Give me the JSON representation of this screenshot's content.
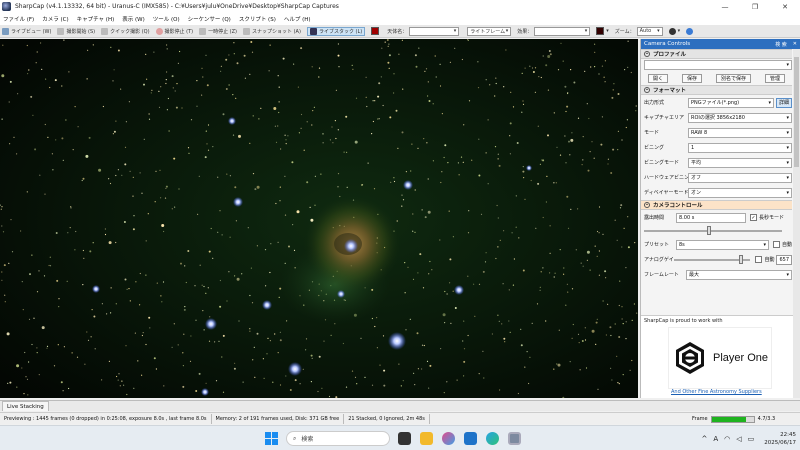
{
  "window": {
    "title": "SharpCap (v4.1.13332, 64 bit) - Uranus-C (IMX585) - C:¥Users¥julu¥OneDrive¥Desktop¥SharpCap Captures",
    "minimize": "—",
    "maximize": "❐",
    "close": "✕"
  },
  "menu": [
    "ファイル (F)",
    "カメラ (C)",
    "キャプチャ (H)",
    "表示 (W)",
    "ツール (O)",
    "シーケンサー (Q)",
    "スクリプト (S)",
    "ヘルプ (H)"
  ],
  "toolbar": {
    "live_view": "ライブビュー (W)",
    "start_capture": "撮影開始 (S)",
    "quick_capture": "クイック撮影 (Q)",
    "stop_capture": "撮影停止 (T)",
    "pause": "一時停止 (Z)",
    "snapshot": "スナップショット (A)",
    "live_stack": "ライブスタック (L)",
    "target_label": "天体名：",
    "frame_select": "ライトフレーム",
    "effect_label": "効果：",
    "zoom_label": "ズーム：",
    "zoom_value": "Auto",
    "target_color": "#a00000",
    "swatch_color": "#330000"
  },
  "camera_controls": {
    "title": "Camera Controls",
    "header_buttons": [
      "検 索",
      "✕"
    ],
    "profile": {
      "label": "プロファイル",
      "buttons": [
        "開く",
        "保存",
        "別名で保存",
        "管理"
      ]
    },
    "format": {
      "label": "フォーマット",
      "rows": [
        {
          "label": "出力形式",
          "value": "PNGファイル(*.png)",
          "extra": "詳細"
        },
        {
          "label": "キャプチャエリア",
          "value": "ROIの選択  3856x2180"
        },
        {
          "label": "モード",
          "value": "RAW 8"
        },
        {
          "label": "ビニング",
          "value": "1"
        },
        {
          "label": "ビニングモード",
          "value": "平均"
        },
        {
          "label": "ハードウェアビニング",
          "value": "オフ"
        },
        {
          "label": "ディベイヤーモード",
          "value": "オン"
        }
      ]
    },
    "controls": {
      "label": "カメラコントロール",
      "exposure_label": "露出時間",
      "exposure_value": "8.00 s",
      "long_mode": "長秒モード",
      "exposure_level": 0.48,
      "preset_label": "プリセット",
      "preset_value": "8s",
      "auto_label": "自動",
      "gain_label": "アナログゲイン",
      "gain_auto": "自動",
      "gain_value": "657",
      "gain_level": 0.88,
      "framelimit_label": "フレームレート",
      "framelimit_value": "最大"
    },
    "banner": {
      "text": "SharpCap is proud to work with",
      "brand": "Player One",
      "link": "And Other Fine Astronomy Suppliers"
    }
  },
  "live_stacking_tab": "Live Stacking",
  "status": {
    "previewing": "Previewing : 1445 frames (0 dropped) in 0:25:08, exposure 8.0s , last frame 8.0s",
    "memory": "Memory: 2 of 191 frames used, Disk: 371 GB free",
    "stacked": "21 Stacked, 0 Ignored, 2m 48s",
    "frame_label": "Frame",
    "frame_progress": 0.82,
    "frame_time": "4.7/3.3"
  },
  "taskbar": {
    "search": "検索",
    "ime": "A",
    "time": "22:45",
    "date": "2025/06/17"
  }
}
